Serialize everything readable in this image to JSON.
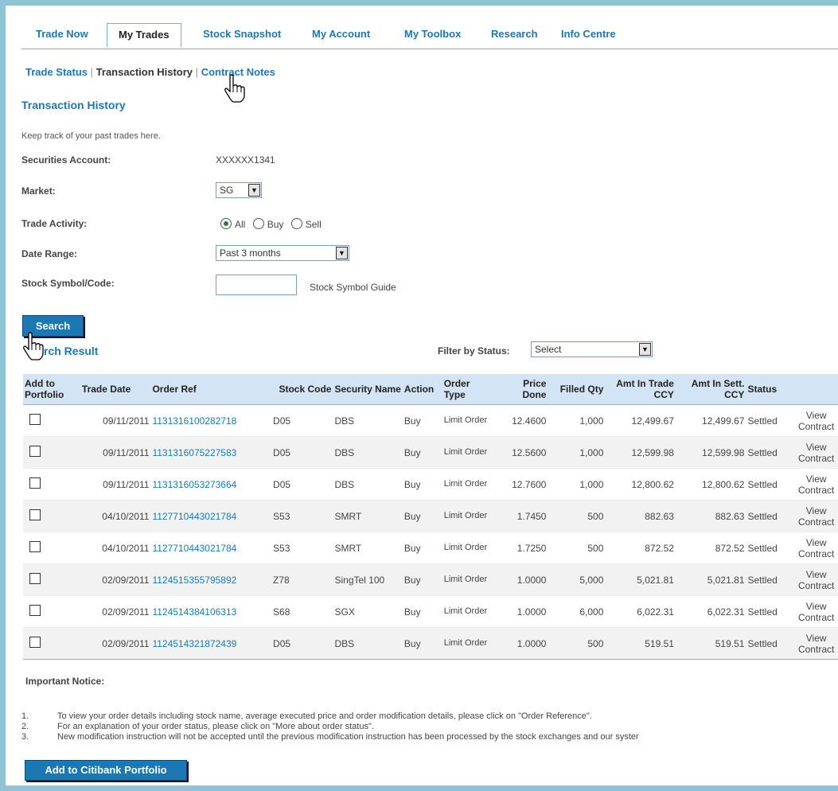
{
  "top_nav": [
    "Trade Now",
    "My Trades",
    "Stock Snapshot",
    "My Account",
    "My Toolbox",
    "Research",
    "Info Centre"
  ],
  "sub_nav": {
    "trade_status": "Trade Status",
    "transaction_history": "Transaction History",
    "contract_notes": "Contract Notes",
    "sep": "|"
  },
  "page": {
    "title": "Transaction History",
    "description": "Keep track of your past trades here.",
    "securities_account_label": "Securities Account:",
    "securities_account_value": "XXXXXX1341",
    "market_label": "Market:",
    "market_value": "SG",
    "trade_activity_label": "Trade Activity:",
    "trade_activity_options": [
      "All",
      "Buy",
      "Sell"
    ],
    "date_range_label": "Date Range:",
    "date_range_value": "Past 3 months",
    "stock_symbol_label": "Stock Symbol/Code:",
    "stock_symbol_guide": "Stock Symbol Guide",
    "search_button": "Search",
    "search_result_title": "rch Result",
    "filter_label": "Filter by Status:",
    "filter_value": "Select"
  },
  "table": {
    "headers": [
      "Add to Portfolio",
      "Trade Date",
      "Order Ref",
      "Stock Code",
      "Security Name",
      "Action",
      "Order Type",
      "Price Done",
      "Filled Qty",
      "Amt In Trade CCY",
      "Amt In Sett. CCY",
      "Status",
      ""
    ],
    "rows": [
      {
        "date": "09/11/2011",
        "ref": "1131316100282718",
        "code": "D05",
        "name": "DBS",
        "action": "Buy",
        "type": "Limit Order",
        "price": "12.4600",
        "qty": "1,000",
        "amt_trade": "12,499.67",
        "amt_sett": "12,499.67",
        "status": "Settled",
        "link": "View Contract"
      },
      {
        "date": "09/11/2011",
        "ref": "1131316075227583",
        "code": "D05",
        "name": "DBS",
        "action": "Buy",
        "type": "Limit Order",
        "price": "12.5600",
        "qty": "1,000",
        "amt_trade": "12,599.98",
        "amt_sett": "12,599.98",
        "status": "Settled",
        "link": "View Contract"
      },
      {
        "date": "09/11/2011",
        "ref": "1131316053273664",
        "code": "D05",
        "name": "DBS",
        "action": "Buy",
        "type": "Limit Order",
        "price": "12.7600",
        "qty": "1,000",
        "amt_trade": "12,800.62",
        "amt_sett": "12,800.62",
        "status": "Settled",
        "link": "View Contract"
      },
      {
        "date": "04/10/2011",
        "ref": "1127710443021784",
        "code": "S53",
        "name": "SMRT",
        "action": "Buy",
        "type": "Limit Order",
        "price": "1.7450",
        "qty": "500",
        "amt_trade": "882.63",
        "amt_sett": "882.63",
        "status": "Settled",
        "link": "View Contract"
      },
      {
        "date": "04/10/2011",
        "ref": "1127710443021784",
        "code": "S53",
        "name": "SMRT",
        "action": "Buy",
        "type": "Limit Order",
        "price": "1.7250",
        "qty": "500",
        "amt_trade": "872.52",
        "amt_sett": "872.52",
        "status": "Settled",
        "link": "View Contract"
      },
      {
        "date": "02/09/2011",
        "ref": "1124515355795892",
        "code": "Z78",
        "name": "SingTel 100",
        "action": "Buy",
        "type": "Limit Order",
        "price": "1.0000",
        "qty": "5,000",
        "amt_trade": "5,021.81",
        "amt_sett": "5,021.81",
        "status": "Settled",
        "link": "View Contract"
      },
      {
        "date": "02/09/2011",
        "ref": "1124514384106313",
        "code": "S68",
        "name": "SGX",
        "action": "Buy",
        "type": "Limit Order",
        "price": "1.0000",
        "qty": "6,000",
        "amt_trade": "6,022.31",
        "amt_sett": "6,022.31",
        "status": "Settled",
        "link": "View Contract"
      },
      {
        "date": "02/09/2011",
        "ref": "1124514321872439",
        "code": "D05",
        "name": "DBS",
        "action": "Buy",
        "type": "Limit Order",
        "price": "1.0000",
        "qty": "500",
        "amt_trade": "519.51",
        "amt_sett": "519.51",
        "status": "Settled",
        "link": "View Contract"
      }
    ]
  },
  "notice": {
    "title": "Important Notice:",
    "items": [
      {
        "num": "1.",
        "text": "To view your order details including stock name, average executed price and order modification details, please click on \"Order Reference\"."
      },
      {
        "num": "2.",
        "text": "For an explanation of your order status, please click on \"More about order status\"."
      },
      {
        "num": "3.",
        "text": "New modification instruction will not be accepted until the previous modification instruction has been processed by the stock exchanges and our syster"
      }
    ]
  },
  "add_portfolio_button": "Add to Citibank Portfolio",
  "colors": {
    "accent": "#1c78b3",
    "header_bg": "#d3e4f4",
    "frame": "#8fc4d8"
  }
}
